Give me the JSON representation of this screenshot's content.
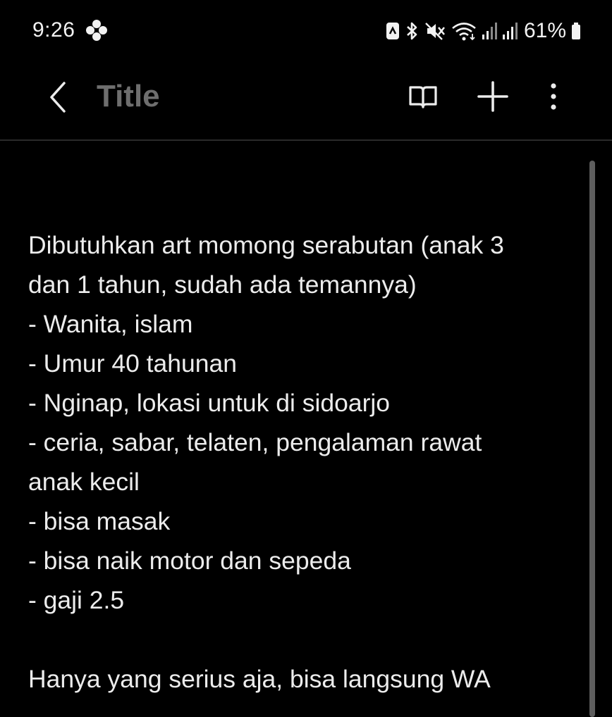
{
  "status_bar": {
    "time": "9:26",
    "battery_percent": "61%",
    "icons": [
      "fan-icon",
      "nfc-icon",
      "bluetooth-icon",
      "mute-icon",
      "wifi-icon",
      "signal-icon",
      "signal-icon",
      "battery-icon"
    ]
  },
  "app_bar": {
    "title": "Title",
    "actions": [
      "back-icon",
      "book-icon",
      "plus-icon",
      "more-vertical-icon"
    ]
  },
  "note": {
    "lines": [
      "Dibutuhkan art momong serabutan (anak 3",
      "dan 1 tahun, sudah ada temannya)",
      "- Wanita, islam",
      "- Umur 40 tahunan",
      "- Nginap, lokasi untuk di sidoarjo",
      "- ceria, sabar, telaten, pengalaman rawat",
      "anak kecil",
      "- bisa masak",
      "- bisa naik motor dan sepeda",
      "- gaji 2.5",
      "",
      "Hanya yang serius aja, bisa langsung WA"
    ]
  },
  "colors": {
    "background": "#000000",
    "text": "#ececec",
    "title_placeholder": "#6e6e6e",
    "divider": "#2a2a2a",
    "scrollbar": "#5e5e5e"
  }
}
